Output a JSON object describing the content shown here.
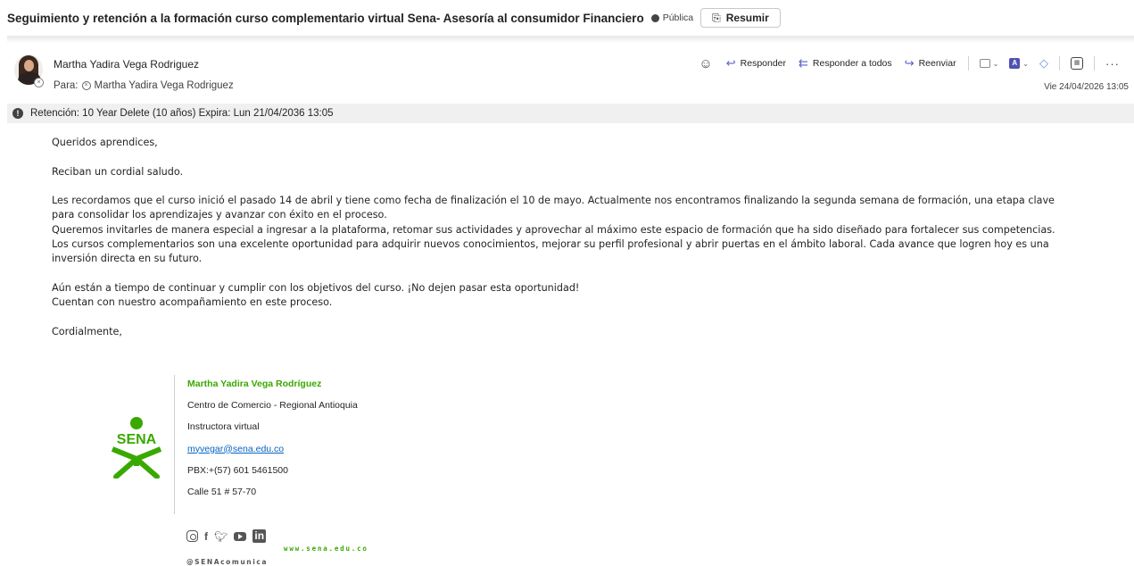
{
  "email": {
    "subject": "Seguimiento y retención a la formación curso complementario virtual Sena- Asesoría al consumidor Financiero",
    "sensitivity_label": "Pública",
    "summarize_label": "Resumir"
  },
  "header": {
    "sender_name": "Martha Yadira Vega Rodriguez",
    "to_prefix": "Para:",
    "recipient": "Martha Yadira Vega Rodriguez",
    "date": "Vie 24/04/2026 13:05",
    "actions": {
      "reply": "Responder",
      "reply_all": "Responder a todos",
      "forward": "Reenviar"
    }
  },
  "retention": {
    "text": "Retención: 10 Year Delete (10 años) Expira: Lun 21/04/2036 13:05"
  },
  "body": {
    "greeting": "Queridos aprendices,",
    "salute": "Reciban un cordial saludo.",
    "p1_line1": "Les recordamos que el curso inició el pasado 14 de abril y tiene como fecha de finalización el 10 de mayo. Actualmente nos encontramos finalizando la segunda semana de formación, una etapa clave",
    "p1_line2": "para consolidar los aprendizajes y avanzar con éxito en el proceso.",
    "p1_line3": "Queremos invitarles de manera especial a ingresar a la plataforma, retomar sus actividades y aprovechar al máximo este espacio de formación que ha sido diseñado para fortalecer sus competencias.",
    "p1_line4": "Los cursos complementarios son una excelente oportunidad para adquirir nuevos conocimientos, mejorar su perfil profesional y abrir puertas en el ámbito laboral. Cada avance que logren hoy es una",
    "p1_line5": "inversión directa en su futuro.",
    "p2_line1": "Aún están a tiempo de continuar y cumplir con los objetivos del curso. ¡No dejen pasar esta oportunidad!",
    "p2_line2": "Cuentan con nuestro acompañamiento en este proceso.",
    "closing": "Cordialmente,"
  },
  "signature": {
    "logo_text": "SENA",
    "name": "Martha Yadira Vega Rodríguez",
    "center": "Centro de Comercio - Regional Antioquia",
    "role": "Instructora virtual",
    "email": "myvegar@sena.edu.co",
    "phone": "PBX:+(57) 601 5461500",
    "address": "Calle 51 # 57-70",
    "website": "www.sena.edu.co",
    "handle": "@SENAcomunica",
    "brand_color": "#39a900",
    "social_icons": [
      "instagram-icon",
      "facebook-icon",
      "twitter-icon",
      "youtube-icon",
      "linkedin-icon"
    ]
  }
}
